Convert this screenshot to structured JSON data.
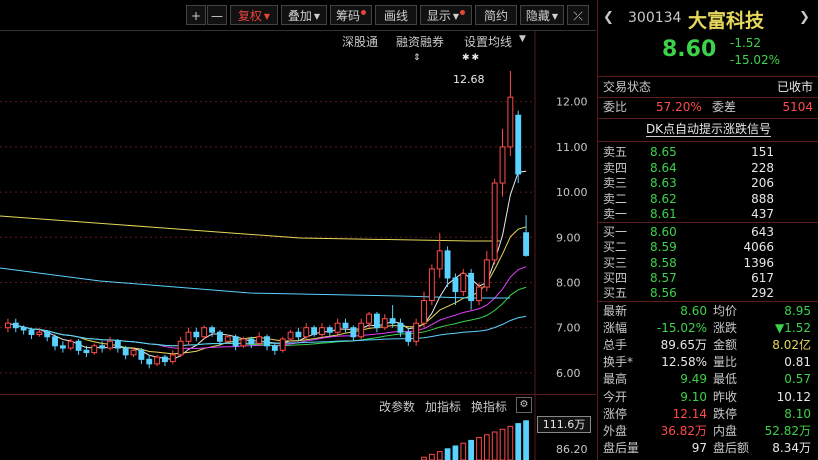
{
  "toolbar": {
    "plus": "+",
    "minus": "—",
    "fuquan": "复权",
    "diejia": "叠加",
    "chouma": "筹码",
    "huaxian": "画线",
    "xianshi": "显示",
    "jianyue": "简约",
    "yincang": "隐藏",
    "expand": "⤫"
  },
  "chart_header": {
    "shengutong": "深股通",
    "rongzi": "融资融券",
    "setma": "设置均线",
    "marker_stars": "✱✱"
  },
  "price_axis": [
    "12.00",
    "11.00",
    "10.00",
    "9.00",
    "8.00",
    "7.00",
    "6.00"
  ],
  "peak_label": "12.68",
  "lower_toolbar": {
    "gaicanshu": "改参数",
    "jiazhibiao": "加指标",
    "huanzhibiao": "换指标"
  },
  "volume_axis": {
    "top": "111.6万",
    "mid": "86.20"
  },
  "quote": {
    "code": "300134",
    "name": "大富科技",
    "price": "8.60",
    "change": "-1.52",
    "change_pct": "-15.02%"
  },
  "status": {
    "label": "交易状态",
    "value": "已收市"
  },
  "weibi": {
    "label": "委比",
    "value": "57.20%",
    "label2": "委差",
    "value2": "5104"
  },
  "signal": "DK点自动提示涨跌信号",
  "asks": [
    {
      "label": "卖五",
      "price": "8.65",
      "vol": "151"
    },
    {
      "label": "卖四",
      "price": "8.64",
      "vol": "228"
    },
    {
      "label": "卖三",
      "price": "8.63",
      "vol": "206"
    },
    {
      "label": "卖二",
      "price": "8.62",
      "vol": "888"
    },
    {
      "label": "卖一",
      "price": "8.61",
      "vol": "437"
    }
  ],
  "bids": [
    {
      "label": "买一",
      "price": "8.60",
      "vol": "643"
    },
    {
      "label": "买二",
      "price": "8.59",
      "vol": "4066"
    },
    {
      "label": "买三",
      "price": "8.58",
      "vol": "1396"
    },
    {
      "label": "买四",
      "price": "8.57",
      "vol": "617"
    },
    {
      "label": "买五",
      "price": "8.56",
      "vol": "292"
    }
  ],
  "stats": [
    {
      "l1": "最新",
      "v1": "8.60",
      "l2": "均价",
      "v2": "8.95"
    },
    {
      "l1": "涨幅",
      "v1": "-15.02%",
      "l2": "涨跌",
      "v2": "▼1.52"
    },
    {
      "l1": "总手",
      "v1": "89.65万",
      "l2": "金额",
      "v2": "8.02亿"
    },
    {
      "l1": "换手*",
      "v1": "12.58%",
      "l2": "量比",
      "v2": "0.81"
    },
    {
      "l1": "最高",
      "v1": "9.49",
      "l2": "最低",
      "v2": "0.57"
    },
    {
      "l1": "今开",
      "v1": "9.10",
      "l2": "昨收",
      "v2": "10.12"
    },
    {
      "l1": "涨停",
      "v1": "12.14",
      "l2": "跌停",
      "v2": "8.10"
    },
    {
      "l1": "外盘",
      "v1": "36.82万",
      "l2": "内盘",
      "v2": "52.82万"
    },
    {
      "l1": "盘后量",
      "v1": "97",
      "l2": "盘后额",
      "v2": "8.34万"
    }
  ],
  "colors": {
    "up": "#ff4a4a",
    "down": "#3cd24b",
    "flat": "#e8e8e8",
    "label": "#c8c8c8",
    "accent_yellow": "#e6d85a"
  },
  "chart_data": {
    "type": "candlestick",
    "ylim": [
      5.6,
      12.9
    ],
    "candles": [
      [
        7.0,
        7.1,
        6.9,
        7.2
      ],
      [
        7.1,
        7.0,
        6.9,
        7.2
      ],
      [
        7.0,
        6.95,
        6.85,
        7.05
      ],
      [
        6.95,
        6.85,
        6.75,
        7.0
      ],
      [
        6.85,
        6.9,
        6.8,
        7.0
      ],
      [
        6.9,
        6.8,
        6.7,
        6.95
      ],
      [
        6.8,
        6.6,
        6.5,
        6.85
      ],
      [
        6.6,
        6.55,
        6.45,
        6.7
      ],
      [
        6.55,
        6.7,
        6.5,
        6.75
      ],
      [
        6.7,
        6.5,
        6.4,
        6.75
      ],
      [
        6.5,
        6.45,
        6.35,
        6.6
      ],
      [
        6.45,
        6.6,
        6.4,
        6.65
      ],
      [
        6.6,
        6.55,
        6.45,
        6.7
      ],
      [
        6.55,
        6.7,
        6.5,
        6.8
      ],
      [
        6.7,
        6.55,
        6.45,
        6.75
      ],
      [
        6.55,
        6.4,
        6.3,
        6.6
      ],
      [
        6.4,
        6.5,
        6.35,
        6.55
      ],
      [
        6.5,
        6.3,
        6.2,
        6.55
      ],
      [
        6.3,
        6.2,
        6.1,
        6.4
      ],
      [
        6.2,
        6.35,
        6.15,
        6.4
      ],
      [
        6.35,
        6.25,
        6.15,
        6.4
      ],
      [
        6.25,
        6.4,
        6.2,
        6.5
      ],
      [
        6.4,
        6.7,
        6.35,
        6.8
      ],
      [
        6.7,
        6.9,
        6.6,
        7.0
      ],
      [
        6.9,
        6.8,
        6.7,
        7.0
      ],
      [
        6.8,
        7.0,
        6.75,
        7.05
      ],
      [
        7.0,
        6.9,
        6.8,
        7.05
      ],
      [
        6.9,
        6.7,
        6.6,
        6.95
      ],
      [
        6.7,
        6.8,
        6.65,
        6.85
      ],
      [
        6.8,
        6.6,
        6.5,
        6.85
      ],
      [
        6.6,
        6.75,
        6.55,
        6.8
      ],
      [
        6.75,
        6.65,
        6.55,
        6.8
      ],
      [
        6.65,
        6.8,
        6.6,
        6.9
      ],
      [
        6.8,
        6.6,
        6.5,
        6.85
      ],
      [
        6.6,
        6.5,
        6.4,
        6.65
      ],
      [
        6.5,
        6.75,
        6.45,
        6.8
      ],
      [
        6.75,
        6.9,
        6.7,
        6.95
      ],
      [
        6.9,
        6.8,
        6.7,
        7.0
      ],
      [
        6.8,
        7.0,
        6.75,
        7.1
      ],
      [
        7.0,
        6.85,
        6.8,
        7.05
      ],
      [
        6.85,
        7.0,
        6.8,
        7.1
      ],
      [
        7.0,
        6.9,
        6.8,
        7.05
      ],
      [
        6.9,
        7.1,
        6.85,
        7.2
      ],
      [
        7.1,
        7.0,
        6.9,
        7.2
      ],
      [
        7.0,
        6.8,
        6.7,
        7.05
      ],
      [
        6.8,
        7.1,
        6.75,
        7.2
      ],
      [
        7.1,
        7.3,
        7.0,
        7.35
      ],
      [
        7.3,
        7.0,
        6.9,
        7.35
      ],
      [
        7.0,
        7.2,
        6.95,
        7.3
      ],
      [
        7.2,
        7.1,
        7.0,
        7.5
      ],
      [
        7.1,
        6.9,
        6.8,
        7.2
      ],
      [
        6.9,
        6.7,
        6.6,
        7.0
      ],
      [
        6.7,
        7.1,
        6.6,
        7.2
      ],
      [
        7.1,
        7.6,
        7.0,
        7.8
      ],
      [
        7.6,
        8.3,
        7.5,
        8.4
      ],
      [
        8.3,
        8.7,
        8.1,
        9.1
      ],
      [
        8.7,
        8.1,
        7.9,
        8.8
      ],
      [
        8.1,
        7.8,
        7.5,
        8.2
      ],
      [
        7.8,
        8.2,
        7.7,
        8.3
      ],
      [
        8.2,
        7.6,
        7.4,
        8.3
      ],
      [
        7.6,
        7.9,
        7.5,
        8.0
      ],
      [
        7.9,
        8.5,
        7.8,
        8.7
      ],
      [
        8.5,
        10.2,
        8.4,
        10.3
      ],
      [
        10.2,
        11.0,
        9.9,
        11.4
      ],
      [
        11.0,
        12.1,
        10.8,
        12.68
      ],
      [
        11.7,
        10.4,
        10.2,
        11.8
      ],
      [
        9.1,
        8.6,
        8.57,
        9.49
      ]
    ]
  }
}
